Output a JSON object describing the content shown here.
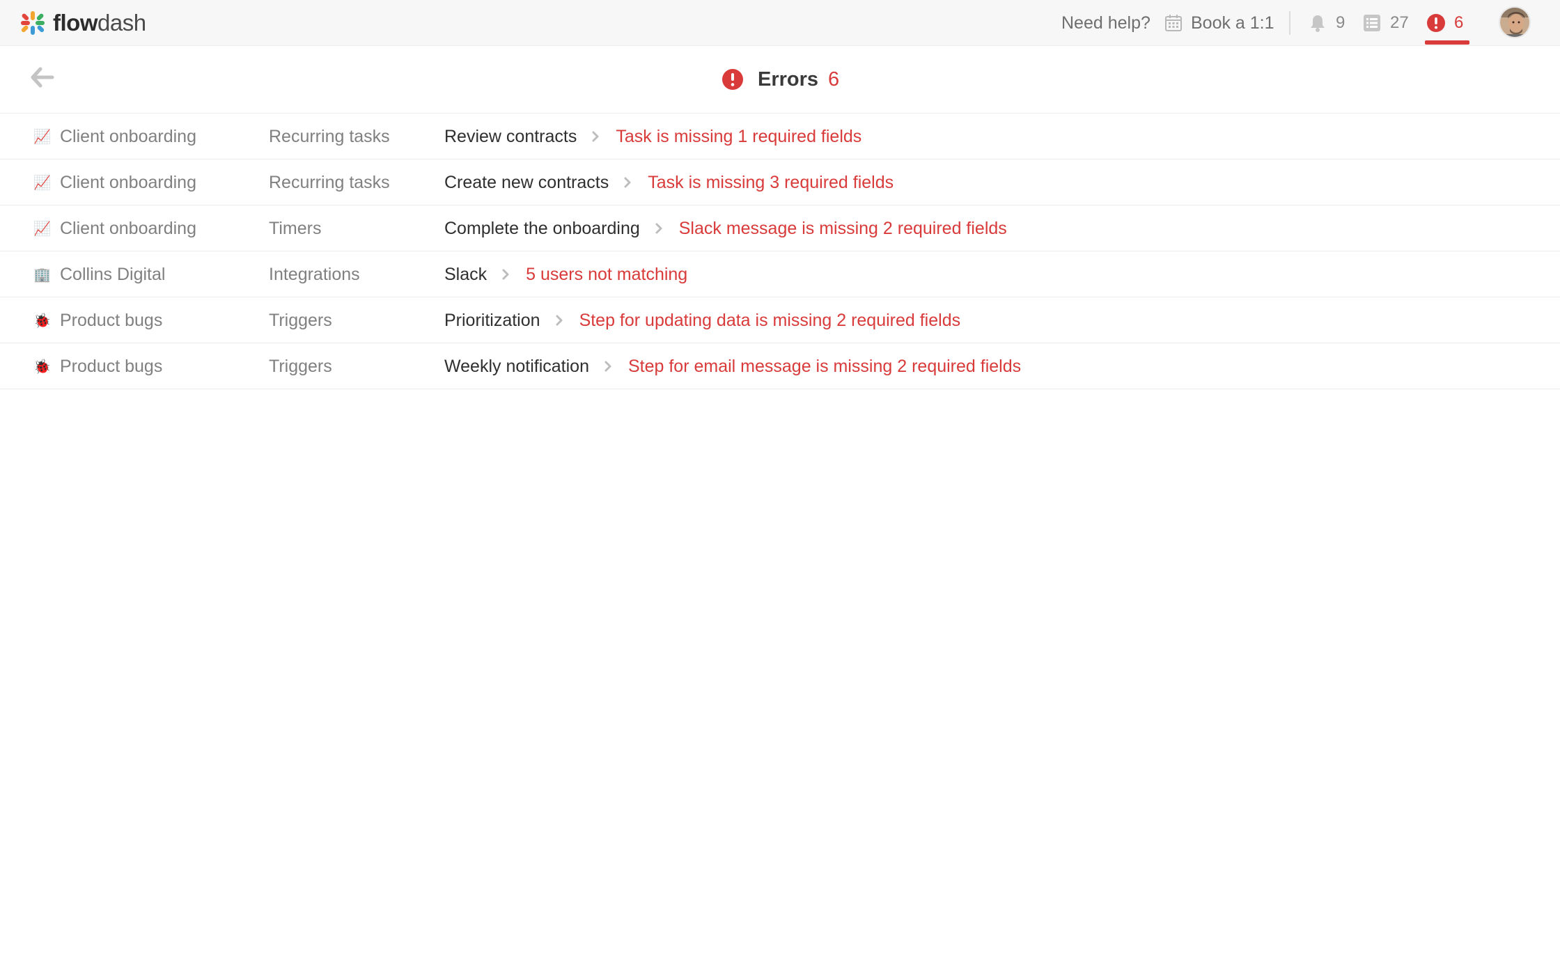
{
  "app": {
    "name_part1": "flow",
    "name_part2": "dash"
  },
  "topbar": {
    "help_label": "Need help?",
    "book_label": "Book a 1:1",
    "notifications_count": "9",
    "tasks_count": "27",
    "errors_count": "6",
    "active_tab": "errors"
  },
  "page": {
    "title": "Errors",
    "count": "6"
  },
  "colors": {
    "accent_error": "#d93a3a",
    "muted_text": "#808080"
  },
  "errors": [
    {
      "source_icon": "chart-emoji",
      "emoji": "📈",
      "source": "Client onboarding",
      "category": "Recurring tasks",
      "item": "Review contracts",
      "message": "Task is missing 1 required fields"
    },
    {
      "source_icon": "chart-emoji",
      "emoji": "📈",
      "source": "Client onboarding",
      "category": "Recurring tasks",
      "item": "Create new contracts",
      "message": "Task is missing 3 required fields"
    },
    {
      "source_icon": "chart-emoji",
      "emoji": "📈",
      "source": "Client onboarding",
      "category": "Timers",
      "item": "Complete the onboarding",
      "message": "Slack message is missing 2 required fields"
    },
    {
      "source_icon": "building-emoji",
      "emoji": "🏢",
      "source": "Collins Digital",
      "category": "Integrations",
      "item": "Slack",
      "message": "5 users not matching"
    },
    {
      "source_icon": "bug-emoji",
      "emoji": "🐞",
      "source": "Product bugs",
      "category": "Triggers",
      "item": "Prioritization",
      "message": "Step for updating data is missing 2 required fields"
    },
    {
      "source_icon": "bug-emoji",
      "emoji": "🐞",
      "source": "Product bugs",
      "category": "Triggers",
      "item": "Weekly notification",
      "message": "Step for email message is missing 2 required fields"
    }
  ]
}
